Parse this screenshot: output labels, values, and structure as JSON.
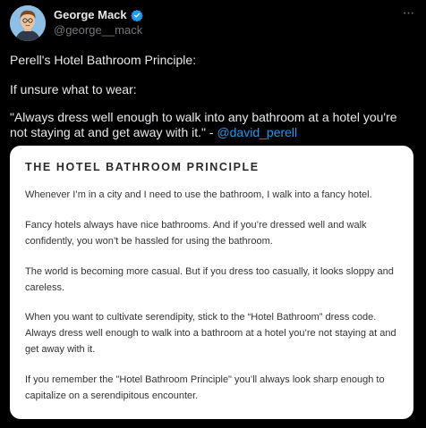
{
  "author": {
    "display_name": "George Mack",
    "handle": "@george__mack",
    "verified": true,
    "avatar_icon": "avatar-cartoon-portrait"
  },
  "tweet": {
    "line1": "Perell's Hotel Bathroom Principle:",
    "line2": "If unsure what to wear:",
    "quote_part1": "\"Always dress well enough to walk into any bathroom at a hotel you're",
    "quote_part2": "not staying at and get away with it.\" - ",
    "mention": "@david_perell"
  },
  "card": {
    "title": "THE HOTEL BATHROOM PRINCIPLE",
    "paragraphs": [
      [
        "Whenever I’m in a city and I need to use the bathroom, I walk into a fancy hotel."
      ],
      [
        "Fancy hotels always have nice bathrooms. And if you’re dressed well and walk",
        "confidently, you won’t be hassled for using the bathroom."
      ],
      [
        "The world is becoming more casual. But if you dress too casually, it looks sloppy and",
        "careless."
      ],
      [
        "When you want to cultivate serendipity, stick to the “Hotel Bathroom” dress code.",
        "Always dress well enough to walk into a bathroom at a hotel you’re not staying at and",
        "get away with it."
      ],
      [
        "If you remember the \"Hotel Bathroom Principle\" you’ll always look sharp enough to",
        "capitalize on a serendipitous encounter."
      ]
    ]
  },
  "colors": {
    "background": "#000000",
    "text": "#e7e9ea",
    "secondary": "#71767b",
    "link": "#1d9bf0",
    "verified": "#1d9bf0"
  }
}
